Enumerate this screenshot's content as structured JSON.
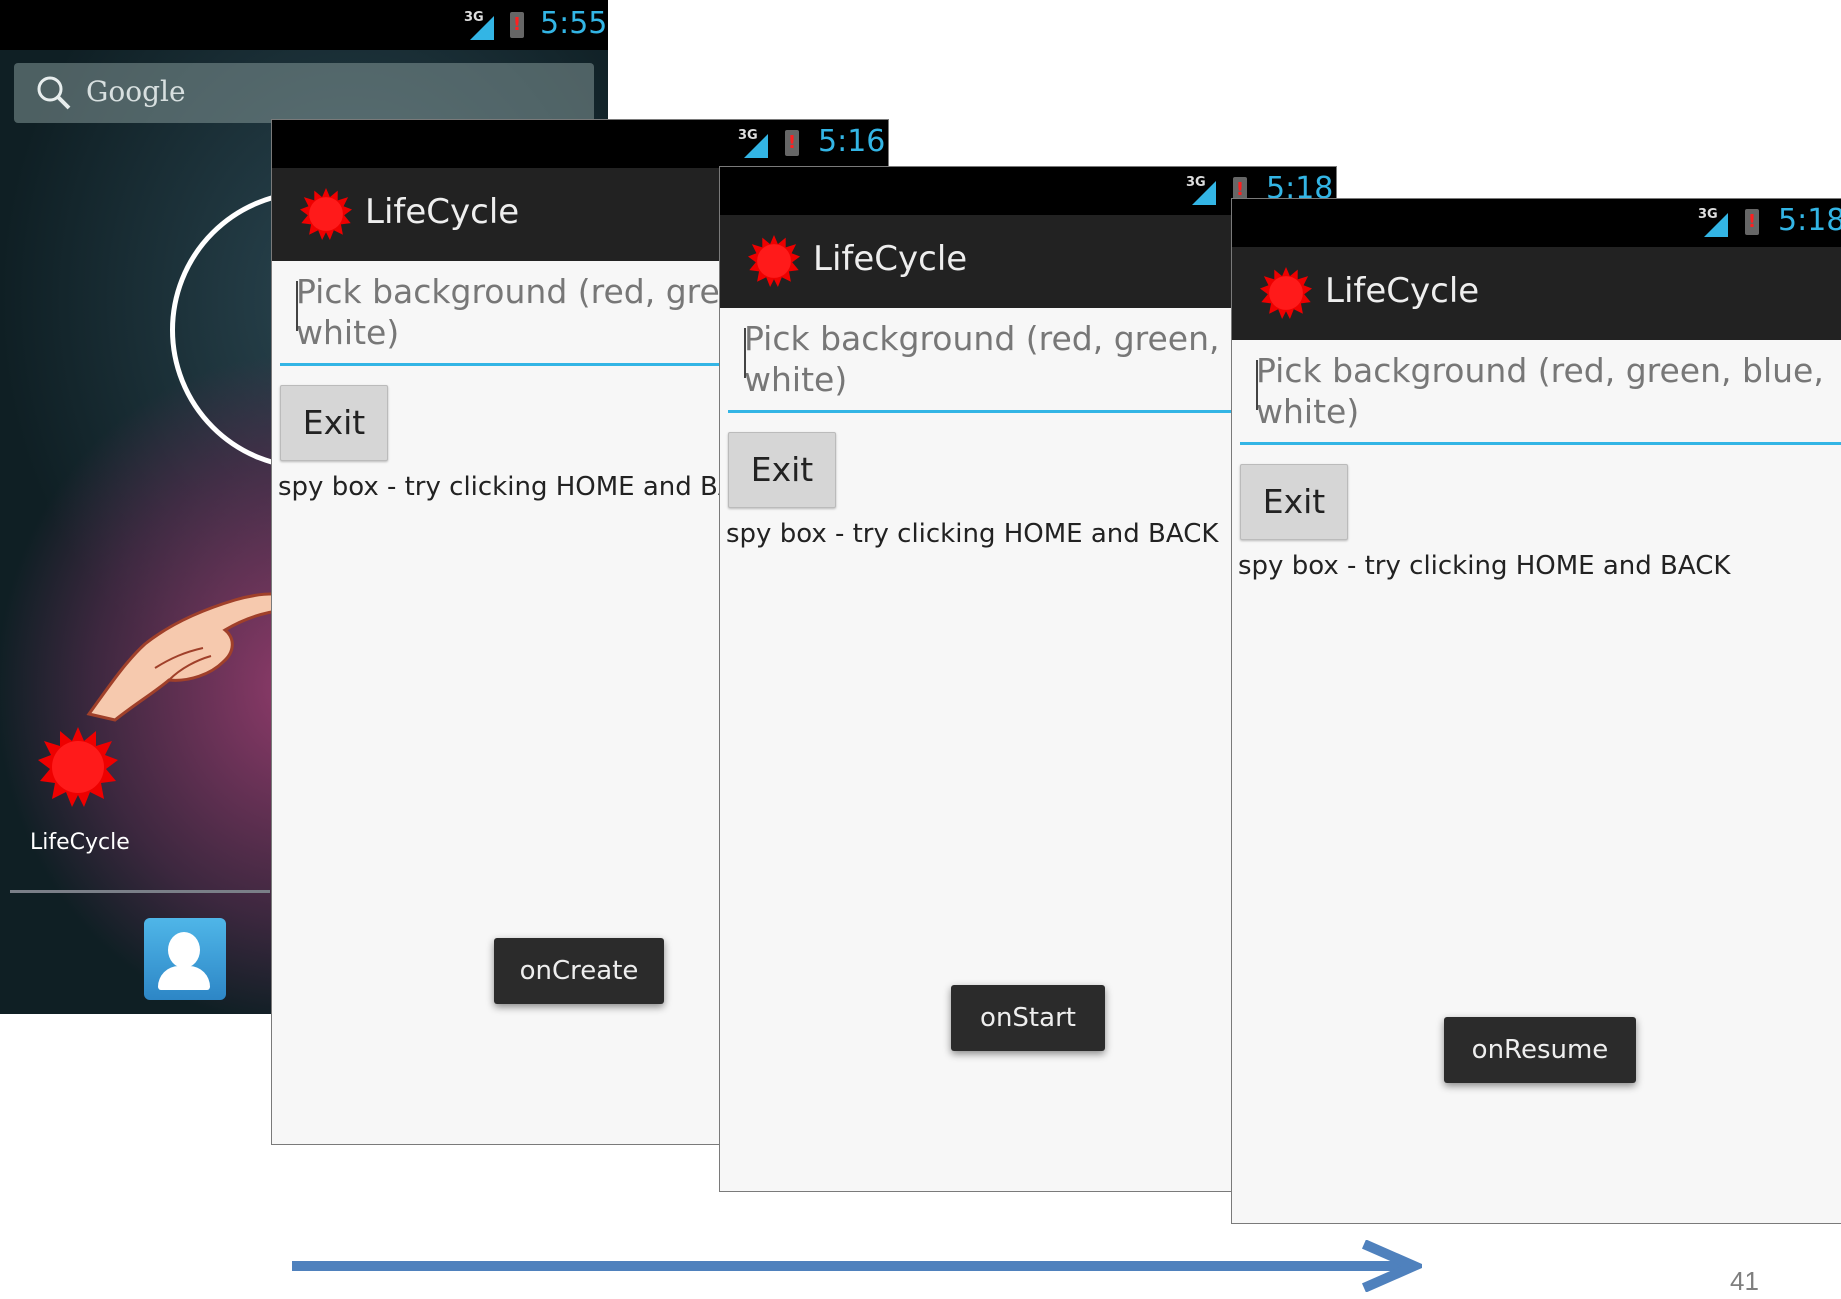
{
  "home": {
    "time": "5:55",
    "network": "3G",
    "search_text": "Google",
    "app_label": "LifeCycle"
  },
  "screens": [
    {
      "time": "5:16",
      "network": "3G",
      "title": "LifeCycle",
      "edit_line1": "Pick background (red, green, blue,",
      "edit_line2": "white)",
      "exit_label": "Exit",
      "spy_text": "spy box - try clicking HOME and BACK",
      "toast": "onCreate"
    },
    {
      "time": "5:18",
      "network": "3G",
      "title": "LifeCycle",
      "edit_line1": "Pick background (red, green, blue,",
      "edit_line2": "white)",
      "exit_label": "Exit",
      "spy_text": "spy box - try clicking HOME and BACK",
      "toast": "onStart"
    },
    {
      "time": "5:18",
      "network": "3G",
      "title": "LifeCycle",
      "edit_line1": "Pick background (red, green, blue,",
      "edit_line2": "white)",
      "exit_label": "Exit",
      "spy_text": "spy box - try clicking HOME and BACK",
      "toast": "onResume"
    }
  ],
  "page_number": "41",
  "colors": {
    "accent": "#33b5e5",
    "actionbar": "#222222",
    "toast_bg": "#2b2b2b",
    "arrow": "#4f81bd",
    "sun": "#ff0000"
  },
  "icons": [
    "search-icon",
    "sun-icon",
    "signal-icon",
    "battery-alert-icon",
    "contacts-icon",
    "pointing-hand-icon"
  ]
}
